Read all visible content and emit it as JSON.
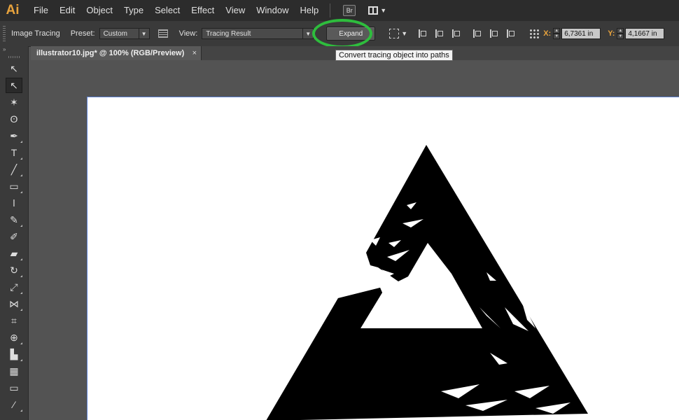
{
  "app": {
    "logo": "Ai"
  },
  "menu": {
    "items": [
      "File",
      "Edit",
      "Object",
      "Type",
      "Select",
      "Effect",
      "View",
      "Window",
      "Help"
    ],
    "bridge_label": "Br"
  },
  "control_bar": {
    "panel_title": "Image Tracing",
    "preset_label": "Preset:",
    "preset_value": "Custom",
    "view_label": "View:",
    "view_value": "Tracing Result",
    "expand_label": "Expand",
    "x_label": "X:",
    "x_value": "6,7361 in",
    "y_label": "Y:",
    "y_value": "4,1667 in"
  },
  "tooltip": {
    "text": "Convert tracing object into paths"
  },
  "document": {
    "tab_title": "illustrator10.jpg* @ 100% (RGB/Preview)",
    "close_glyph": "×"
  },
  "tools": [
    {
      "name": "selection-tool",
      "glyph": "↖"
    },
    {
      "name": "direct-selection-tool",
      "glyph": "↖"
    },
    {
      "name": "magic-wand-tool",
      "glyph": "✶"
    },
    {
      "name": "lasso-tool",
      "glyph": "ʘ"
    },
    {
      "name": "pen-tool",
      "glyph": "✒"
    },
    {
      "name": "type-tool",
      "glyph": "T"
    },
    {
      "name": "line-tool",
      "glyph": "╱"
    },
    {
      "name": "rectangle-tool",
      "glyph": "▭"
    },
    {
      "name": "paintbrush-tool",
      "glyph": "ǀ"
    },
    {
      "name": "pencil-tool",
      "glyph": "✎"
    },
    {
      "name": "blob-brush-tool",
      "glyph": "✐"
    },
    {
      "name": "eraser-tool",
      "glyph": "▰"
    },
    {
      "name": "rotate-tool",
      "glyph": "↻"
    },
    {
      "name": "scale-tool",
      "glyph": "⤢"
    },
    {
      "name": "width-tool",
      "glyph": "⋈"
    },
    {
      "name": "free-transform-tool",
      "glyph": "⌗"
    },
    {
      "name": "shape-builder-tool",
      "glyph": "⊕"
    },
    {
      "name": "graph-tool",
      "glyph": "▙"
    },
    {
      "name": "mesh-tool",
      "glyph": "▦"
    },
    {
      "name": "gradient-tool",
      "glyph": "▭"
    },
    {
      "name": "eyedropper-tool",
      "glyph": "⁄"
    }
  ],
  "colors": {
    "accent_ring": "#2ebd3d",
    "ai_logo": "#e8a33d"
  }
}
